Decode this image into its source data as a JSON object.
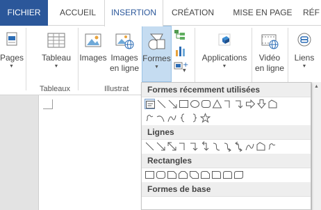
{
  "tabs": [
    "FICHIER",
    "ACCUEIL",
    "INSERTION",
    "CRÉATION",
    "MISE EN PAGE",
    "RÉF"
  ],
  "active_tab": "INSERTION",
  "ribbon": {
    "pages_label": "Pages",
    "tableau_label": "Tableau",
    "images_label": "Images",
    "images_en_ligne_line1": "Images",
    "images_en_ligne_line2": "en ligne",
    "formes_label": "Formes",
    "applications_label": "Applications",
    "video_line1": "Vidéo",
    "video_line2": "en ligne",
    "liens_label": "Liens",
    "group_tableaux": "Tableaux",
    "group_illustrations": "Illustrat"
  },
  "shapes_panel": {
    "sections": [
      "Formes récemment utilisées",
      "Lignes",
      "Rectangles",
      "Formes de base"
    ]
  },
  "colors": {
    "file_tab": "#2b579a",
    "active_tab_text": "#2b579a",
    "pressed_button": "#c5dcf1",
    "accent_orange": "#e8a33c",
    "icon_blue": "#2b6cb5"
  }
}
